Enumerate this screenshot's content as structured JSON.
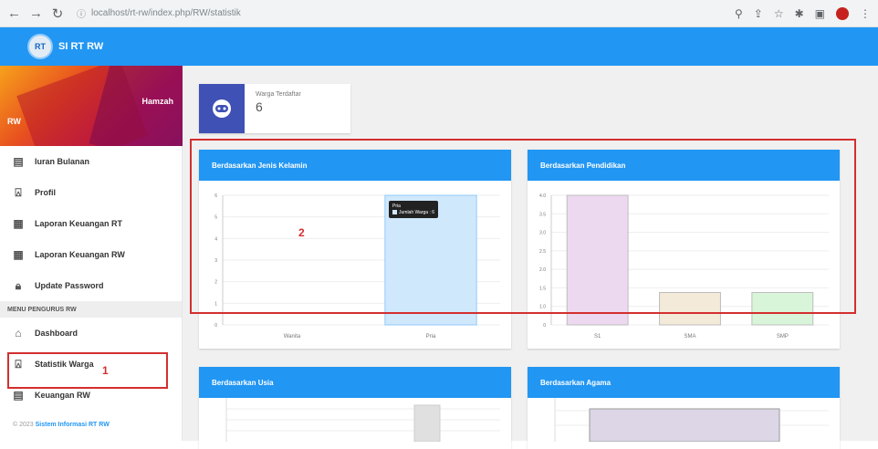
{
  "browser": {
    "url": "localhost/rt-rw/index.php/RW/statistik",
    "back_icon": "arrow-left-icon",
    "forward_icon": "arrow-right-icon",
    "reload_icon": "reload-icon"
  },
  "app": {
    "brand": "SI RT RW",
    "logo_text": "RT",
    "user_name": "Hamzah",
    "user_role": "RW"
  },
  "sidebar": {
    "items": [
      {
        "label": "Iuran Bulanan",
        "icon": "calendar-icon"
      },
      {
        "label": "Profil",
        "icon": "person-icon"
      },
      {
        "label": "Laporan Keuangan RT",
        "icon": "report-icon"
      },
      {
        "label": "Laporan Keuangan RW",
        "icon": "report-icon"
      },
      {
        "label": "Update Password",
        "icon": "lock-icon"
      }
    ],
    "section_header": "MENU PENGURUS RW",
    "pengurus_items": [
      {
        "label": "Dashboard",
        "icon": "home-icon"
      },
      {
        "label": "Statistik Warga",
        "icon": "person-icon"
      },
      {
        "label": "Keuangan RW",
        "icon": "calendar-icon"
      }
    ],
    "footer_prefix": "© 2023",
    "footer_link": "Sistem Informasi RT RW"
  },
  "annotations": {
    "one": "1",
    "two": "2"
  },
  "info_card": {
    "label": "Warga Terdaftar",
    "value": "6"
  },
  "panels": {
    "gender": "Berdasarkan Jenis Kelamin",
    "education": "Berdasarkan Pendidikan",
    "age": "Berdasarkan Usia",
    "religion": "Berdasarkan Agama"
  },
  "tooltip": {
    "title": "Pria",
    "series": "Jumlah Warga",
    "value": "6"
  },
  "chart_data": [
    {
      "type": "bar",
      "title": "Berdasarkan Jenis Kelamin",
      "categories": [
        "Wanita",
        "Pria"
      ],
      "values": [
        0,
        6
      ],
      "ylim": [
        0,
        6
      ],
      "yticks": [
        "0",
        "1",
        "2",
        "3",
        "4",
        "5",
        "6"
      ],
      "colors": [
        "#cfe8fc"
      ]
    },
    {
      "type": "bar",
      "title": "Berdasarkan Pendidikan",
      "categories": [
        "S1",
        "SMA",
        "SMP"
      ],
      "values": [
        4,
        1,
        1
      ],
      "ylim": [
        0,
        4
      ],
      "yticks": [
        "0",
        "1.0",
        "1.5",
        "2.0",
        "2.5",
        "3.0",
        "3.5",
        "4.0"
      ],
      "colors": [
        "#ecd9f0",
        "#f3ead9",
        "#d9f5d9"
      ]
    },
    {
      "type": "bar",
      "title": "Berdasarkan Usia",
      "categories": [],
      "values": []
    },
    {
      "type": "bar",
      "title": "Berdasarkan Agama",
      "categories": [],
      "values": []
    }
  ],
  "colors": {
    "primary": "#2196f3",
    "annotation": "#d32f2f",
    "info_icon_bg": "#3f51b5"
  }
}
